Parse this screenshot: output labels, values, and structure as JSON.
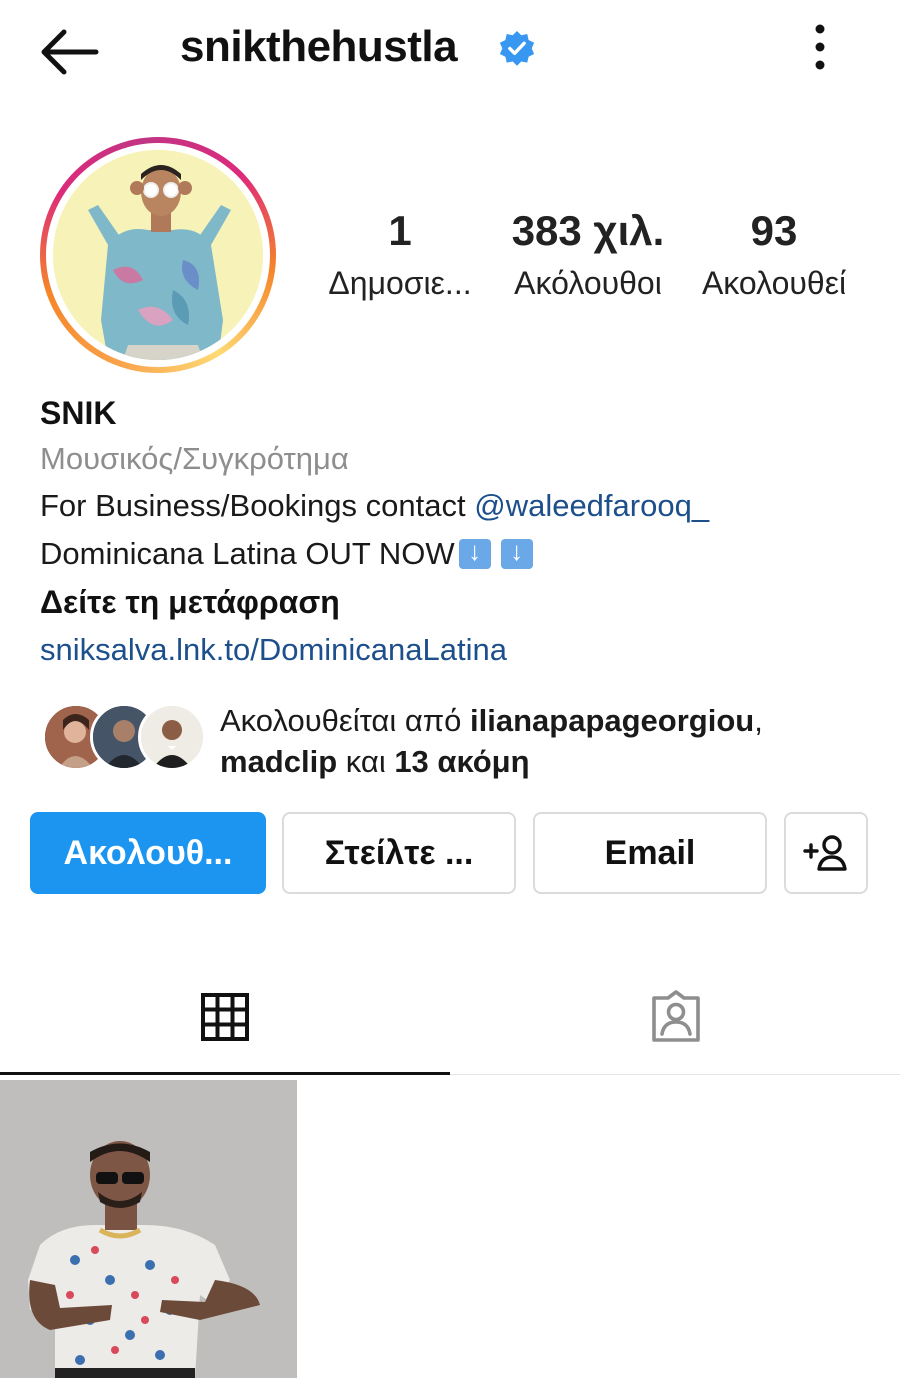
{
  "header": {
    "username": "snikthehustla",
    "verified_icon": "verified-badge-icon",
    "back_icon": "back-arrow-icon",
    "more_icon": "more-vertical-icon"
  },
  "stats": [
    {
      "value": "1",
      "label": "Δημοσιε..."
    },
    {
      "value": "383 χιλ.",
      "label": "Ακόλουθοι"
    },
    {
      "value": "93",
      "label": "Ακολουθεί"
    }
  ],
  "profile": {
    "name": "SNIK",
    "category": "Μουσικός/Συγκρότημα",
    "bio_line1_prefix": "For Business/Bookings contact ",
    "bio_line1_mention": "@waleedfarooq_",
    "bio_line2": "Dominicana Latina OUT NOW",
    "see_translation": "Δείτε τη μετάφραση",
    "link": "sniksalva.lnk.to/DominicanaLatina"
  },
  "followed_by": {
    "prefix": "Ακολουθείται από ",
    "user1": "ilianapapageorgiou",
    "sep": ",",
    "user2": "madclip",
    "middle": " και ",
    "others": "13 ακόμη"
  },
  "actions": {
    "follow": "Ακολουθ...",
    "message": "Στείλτε ...",
    "email": "Email",
    "suggest_icon": "add-person-icon"
  },
  "colors": {
    "accent": "#1b95f0",
    "link": "#1d4f8c",
    "muted": "#8e8e8e",
    "verified": "#3897f0"
  },
  "tabs": [
    {
      "icon": "grid-icon",
      "active": true
    },
    {
      "icon": "tagged-person-icon",
      "active": false
    }
  ]
}
